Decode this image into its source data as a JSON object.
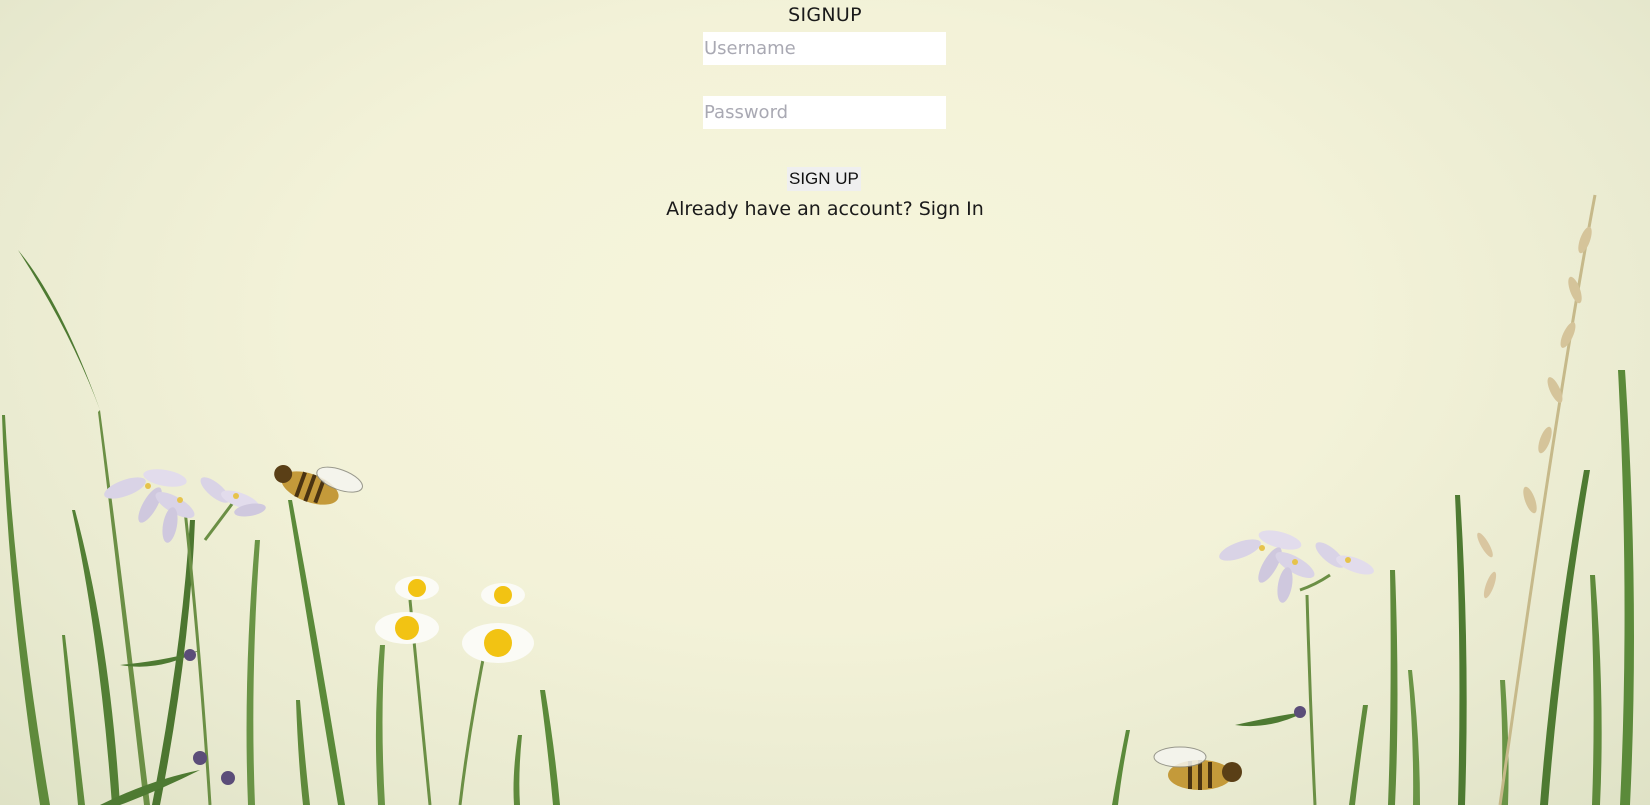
{
  "page": {
    "title": "SIGNUP"
  },
  "form": {
    "username_placeholder": "Username",
    "password_placeholder": "Password",
    "submit_label": "SIGN UP"
  },
  "footer": {
    "prompt": "Already have an account?",
    "link_label": "Sign In"
  },
  "background": {
    "theme": "meadow-illustration",
    "elements": [
      "grass-blades",
      "lilac-flowers",
      "daisies",
      "bees",
      "wheat-stalk"
    ]
  },
  "colors": {
    "background": "#f3f2d8",
    "grass": "#5f8a3c",
    "petal": "#d9d3e6",
    "daisy_center": "#f2c313",
    "bee": "#c49a3a"
  }
}
